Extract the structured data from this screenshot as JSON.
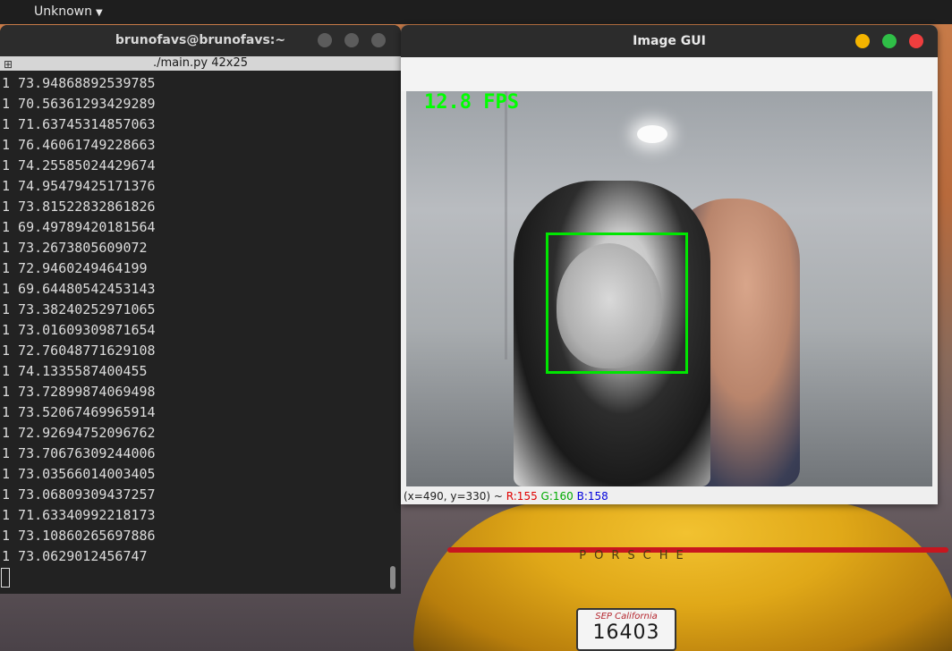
{
  "top_panel": {
    "menu_label": "Unknown"
  },
  "terminal": {
    "title": "brunofavs@brunofavs:~",
    "tab_title": "./main.py 42x25",
    "lines": [
      "1 73.94868892539785",
      "1 70.56361293429289",
      "1 71.63745314857063",
      "1 76.46061749228663",
      "1 74.25585024429674",
      "1 74.95479425171376",
      "1 73.81522832861826",
      "1 69.49789420181564",
      "1 73.2673805609072",
      "1 72.9460249464199",
      "1 69.64480542453143",
      "1 73.38240252971065",
      "1 73.01609309871654",
      "1 72.76048771629108",
      "1 74.1335587400455",
      "1 73.72899874069498",
      "1 73.52067469965914",
      "1 72.92694752096762",
      "1 73.70676309244006",
      "1 73.03566014003405",
      "1 73.06809309437257",
      "1 71.63340992218173",
      "1 73.10860265697886",
      "1 73.0629012456747"
    ]
  },
  "image_gui": {
    "title": "Image GUI",
    "fps_overlay": "12.8 FPS",
    "status_coords": "(x=490, y=330) ~ ",
    "status_r": "R:155",
    "status_g": "G:160",
    "status_b": "B:158",
    "colors": {
      "minimize": "#f4b400",
      "maximize": "#2fbf47",
      "close": "#ee3e3e",
      "detection_box": "#00e600",
      "fps_text": "#00ff00"
    }
  },
  "wallpaper": {
    "car_brand": "PORSCHE",
    "plate_state": "California",
    "plate_month": "SEP",
    "plate_number": "16403"
  }
}
